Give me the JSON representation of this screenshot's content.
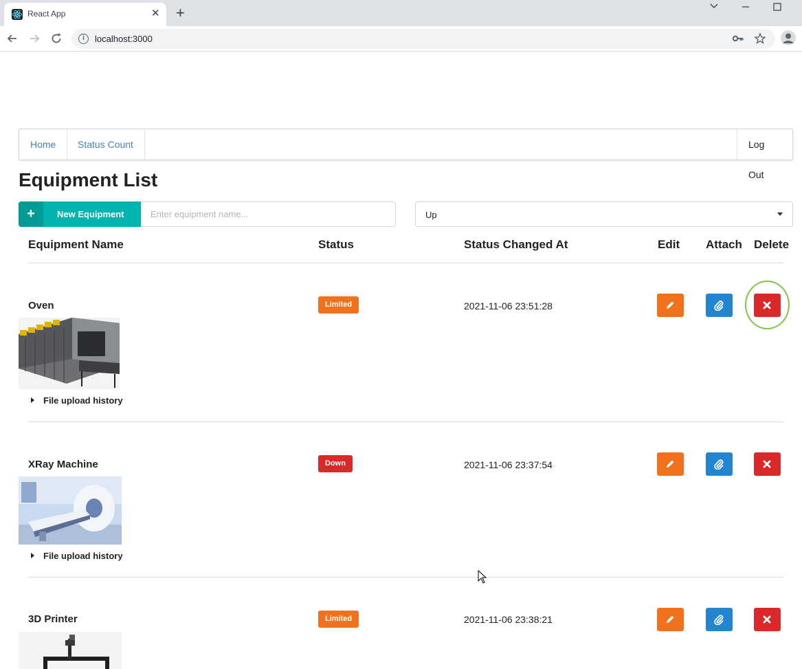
{
  "browser": {
    "tab_title": "React App",
    "url": "localhost:3000"
  },
  "nav": {
    "home": "Home",
    "status_count": "Status Count",
    "logout": "Log Out"
  },
  "page": {
    "title": "Equipment List",
    "new_button": "New Equipment",
    "search_placeholder": "Enter equipment name...",
    "status_filter": "Up"
  },
  "table": {
    "headers": {
      "name": "Equipment Name",
      "status": "Status",
      "changed_at": "Status Changed At",
      "edit": "Edit",
      "attach": "Attach",
      "delete": "Delete"
    },
    "history_label": "File upload history",
    "rows": [
      {
        "name": "Oven",
        "status": "Limited",
        "status_color": "#f2711c",
        "changed_at": "2021-11-06 23:51:28"
      },
      {
        "name": "XRay Machine",
        "status": "Down",
        "status_color": "#db2828",
        "changed_at": "2021-11-06 23:37:54"
      },
      {
        "name": "3D Printer",
        "status": "Limited",
        "status_color": "#f2711c",
        "changed_at": "2021-11-06 23:38:21"
      }
    ]
  },
  "colors": {
    "teal": "#00b5ad",
    "orange": "#f2711c",
    "blue": "#2185d0",
    "red": "#db2828",
    "link": "#4183c4"
  },
  "icons": [
    "pencil-icon",
    "paperclip-icon",
    "close-icon",
    "plus-icon"
  ]
}
